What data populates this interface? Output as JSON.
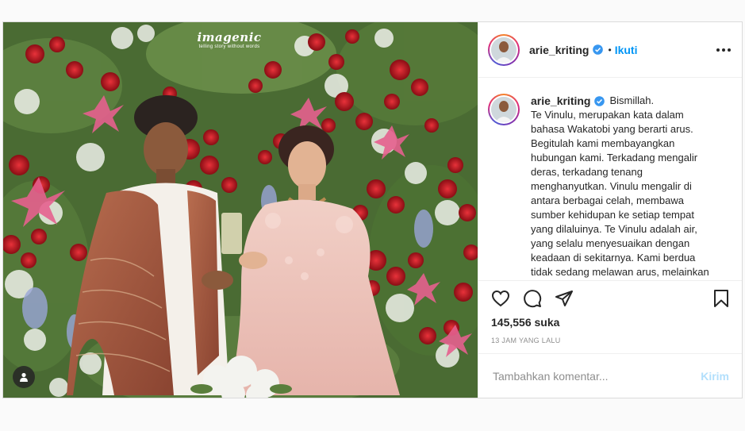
{
  "post": {
    "watermark": {
      "brand": "imagenic",
      "tagline": "telling story without words"
    },
    "author": {
      "username": "arie_kriting",
      "verified": true,
      "follow_label": "Ikuti",
      "separator": "•"
    },
    "caption": {
      "first_line": "Bismillah.",
      "body": "Te Vinulu, merupakan kata dalam bahasa Wakatobi yang berarti arus. Begitulah kami membayangkan hubungan kami. Terkadang mengalir deras, terkadang tenang menghanyutkan. Vinulu mengalir di antara berbagai celah, membawa sumber kehidupan ke setiap tempat yang dilaluinya. Te Vinulu adalah air, yang selalu menyesuaikan dengan keadaan di sekitarnya. Kami berdua tidak sedang melawan arus, melainkan"
    },
    "likes_text": "145,556 suka",
    "timestamp": "13 JAM YANG LALU",
    "comment": {
      "placeholder": "Tambahkan komentar...",
      "post_label": "Kirim"
    },
    "colors": {
      "accent": "#0095f6",
      "post_disabled": "#b2dffc",
      "text": "#262626",
      "muted": "#8e8e8e",
      "border": "#dbdbdb"
    },
    "icons": {
      "like": "heart-icon",
      "comment": "comment-icon",
      "share": "paper-plane-icon",
      "save": "bookmark-icon",
      "more": "more-dots-icon",
      "tagged_user": "user-icon",
      "verified": "verified-badge-icon"
    }
  }
}
